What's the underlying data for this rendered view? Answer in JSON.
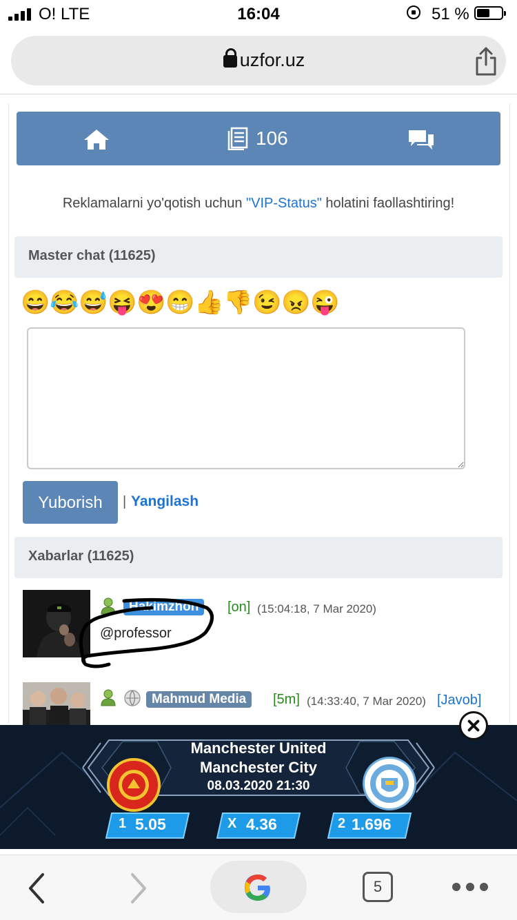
{
  "status_bar": {
    "carrier": "O!  LTE",
    "time": "16:04",
    "battery_percent": "51 %",
    "icons": [
      "signal-icon",
      "orientation-lock-icon",
      "battery-icon"
    ]
  },
  "browser": {
    "url": "uzfor.uz",
    "open_tabs": "5"
  },
  "nav": {
    "message_count": "106",
    "icons": [
      "home-icon",
      "documents-icon",
      "chat-bubbles-icon"
    ]
  },
  "ad_notice": {
    "prefix": "Reklamalarni yo'qotish uchun ",
    "link": "\"VIP-Status\"",
    "suffix": " holatini faollashtiring!"
  },
  "chat_section": {
    "title": "Master chat (11625)",
    "emojis": [
      "😄",
      "😂",
      "😅",
      "😝",
      "😍",
      "😁",
      "👍",
      "👎",
      "😉",
      "😠",
      "😜"
    ],
    "input_value": "",
    "send_label": "Yuborish",
    "separator": "|",
    "refresh_label": "Yangilash"
  },
  "messages_section": {
    "title": "Xabarlar (11625)"
  },
  "messages": [
    {
      "username": "Hakimzhon",
      "status": "[on]",
      "time": "(15:04:18, 7 Mar 2020)",
      "text": "@professor",
      "tag_color": "#3d8fe0"
    },
    {
      "username": "Mahmud Media",
      "status": "[5m]",
      "time": "(14:33:40, 7 Mar 2020)",
      "reply": "[Javob]",
      "tag_color": "#6686a8"
    }
  ],
  "betting_banner": {
    "home_team": "Manchester United",
    "away_team": "Manchester City",
    "datetime": "08.03.2020 21:30",
    "odds": [
      {
        "label": "1",
        "value": "5.05"
      },
      {
        "label": "X",
        "value": "4.36"
      },
      {
        "label": "2",
        "value": "1.696"
      }
    ],
    "colors": {
      "background": "#0d1a2b",
      "odds": "#1e9be8",
      "home_crest": "#d8261c",
      "away_crest": "#6cabdd"
    }
  }
}
